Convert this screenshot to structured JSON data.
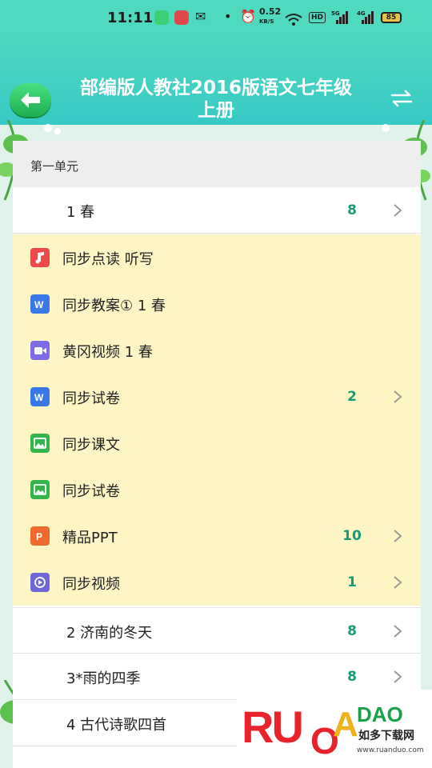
{
  "status_bar": {
    "time": "11:11",
    "net_speed_value": "0.52",
    "net_speed_unit": "KB/S",
    "hd_label": "HD",
    "sim1_label": "5G",
    "sim2_label": "4G",
    "battery": "85"
  },
  "header": {
    "title_line1": "部编版人教社2016版语文七年级",
    "title_line2": "上册",
    "back_icon": "back-arrow-icon",
    "switch_icon": "switch-arrows-icon"
  },
  "unit": {
    "title": "第一单元"
  },
  "lessons_top": [
    {
      "label": "1 春",
      "count": "8"
    }
  ],
  "resources": [
    {
      "label": "同步点读 听写",
      "icon": "music-file-icon",
      "color": "#ef4a4a",
      "count": ""
    },
    {
      "label": "同步教案① 1 春",
      "icon": "word-file-icon",
      "color": "#3b78e7",
      "count": ""
    },
    {
      "label": "黄冈视频 1 春",
      "icon": "video-file-icon",
      "color": "#7f6be6",
      "count": ""
    },
    {
      "label": "同步试卷",
      "icon": "word-file-icon",
      "color": "#3b78e7",
      "count": "2"
    },
    {
      "label": "同步课文",
      "icon": "image-file-icon",
      "color": "#35b44a",
      "count": ""
    },
    {
      "label": "同步试卷",
      "icon": "image-file-icon",
      "color": "#35b44a",
      "count": ""
    },
    {
      "label": "精品PPT",
      "icon": "ppt-file-icon",
      "color": "#f06a2f",
      "count": "10"
    },
    {
      "label": "同步视频",
      "icon": "video-play-icon",
      "color": "#6f66d8",
      "count": "1"
    }
  ],
  "lessons_bottom": [
    {
      "label": "2 济南的冬天",
      "count": "8"
    },
    {
      "label": "3*雨的四季",
      "count": "8"
    },
    {
      "label": "4 古代诗歌四首",
      "count": ""
    }
  ],
  "watermark": {
    "brand": "RUANDAO",
    "cn": "如多下载网",
    "url": "www.ruanduo.com"
  },
  "colors": {
    "header": "#4fd9bf",
    "back_button": "#22b552",
    "count_text": "#199977",
    "resource_bg": "#fdf6c4"
  }
}
